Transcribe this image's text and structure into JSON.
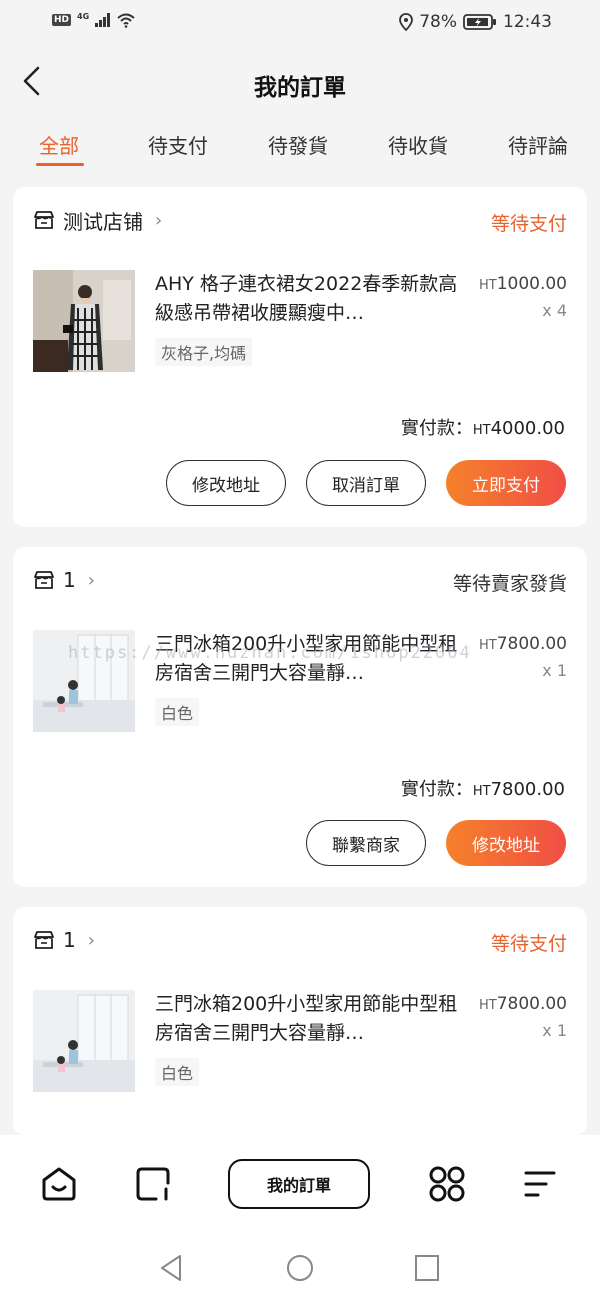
{
  "status_bar": {
    "hd": "HD",
    "network": "4G",
    "battery": "78%",
    "time": "12:43"
  },
  "header": {
    "title": "我的訂單"
  },
  "tabs": [
    {
      "label": "全部",
      "active": true
    },
    {
      "label": "待支付",
      "active": false
    },
    {
      "label": "待發貨",
      "active": false
    },
    {
      "label": "待收貨",
      "active": false
    },
    {
      "label": "待評論",
      "active": false
    }
  ],
  "orders": [
    {
      "shop": "测试店铺",
      "status": "等待支付",
      "status_color": "#e8622b",
      "product_title": "AHY 格子連衣裙女2022春季新款高級感吊帶裙收腰顯瘦中…",
      "variant": "灰格子,均碼",
      "currency": "HT",
      "price": "1000.00",
      "qty": "x 4",
      "paid_label": "實付款：",
      "paid_amount": "4000.00",
      "buttons": [
        "修改地址",
        "取消訂單",
        "立即支付"
      ]
    },
    {
      "shop": "1",
      "status": "等待賣家發貨",
      "status_color": "#333333",
      "product_title": "三門冰箱200升小型家用節能中型租房宿舍三開門大容量靜…",
      "variant": "白色",
      "currency": "HT",
      "price": "7800.00",
      "qty": "x 1",
      "paid_label": "實付款：",
      "paid_amount": "7800.00",
      "buttons": [
        "聯繫商家",
        "修改地址"
      ]
    },
    {
      "shop": "1",
      "status": "等待支付",
      "status_color": "#e8622b",
      "product_title": "三門冰箱200升小型家用節能中型租房宿舍三開門大容量靜…",
      "variant": "白色",
      "currency": "HT",
      "price": "7800.00",
      "qty": "x 1"
    }
  ],
  "watermark": "https://www.huzhan.com/1shop22064",
  "bottom_nav": {
    "items": [
      "home-icon",
      "square-icon",
      "grid-icon",
      "menu-icon"
    ],
    "orders_label": "我的訂單"
  },
  "colors": {
    "accent": "#e8622b",
    "button_gradient_start": "#f5812a",
    "button_gradient_end": "#f04e45"
  }
}
